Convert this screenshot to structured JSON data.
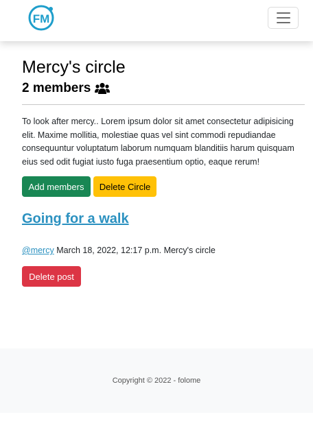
{
  "navbar": {
    "brand": "FM",
    "brand_color": "#1e9ecb",
    "toggler_icon": "hamburger-icon"
  },
  "circle": {
    "name": "Mercy's circle",
    "members_text": "2 members",
    "members_icon": "users-icon",
    "description": "To look after mercy.. Lorem ipsum dolor sit amet consectetur adipisicing elit. Maxime mollitia, molestiae quas vel sint commodi repudiandae consequuntur voluptatum laborum numquam blanditiis harum quisquam eius sed odit fugiat iusto fuga praesentium optio, eaque rerum!",
    "add_members_label": "Add members",
    "delete_circle_label": "Delete Circle"
  },
  "post": {
    "title": "Going for a walk",
    "author": "@mercy",
    "date": "March 18, 2022, 12:17 p.m.",
    "circle": "Mercy's circle",
    "delete_label": "Delete post"
  },
  "footer": {
    "text": "Copyright © 2022 - folome"
  },
  "colors": {
    "success": "#198754",
    "warning": "#ffc107",
    "danger": "#dc3545",
    "link": "#2b91c0"
  }
}
